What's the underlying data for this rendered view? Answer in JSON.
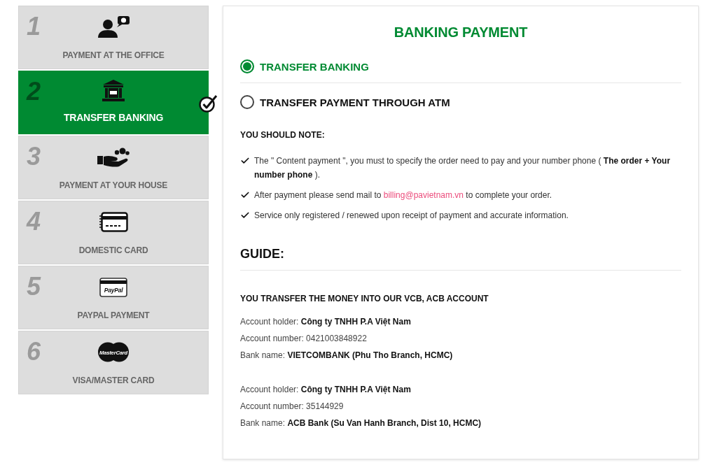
{
  "payment_methods": [
    {
      "number": "1",
      "label": "PAYMENT AT THE OFFICE",
      "kind": "office",
      "selected": false
    },
    {
      "number": "2",
      "label": "TRANSFER BANKING",
      "kind": "bank",
      "selected": true
    },
    {
      "number": "3",
      "label": "PAYMENT AT YOUR HOUSE",
      "kind": "hand",
      "selected": false
    },
    {
      "number": "4",
      "label": "DOMESTIC CARD",
      "kind": "card",
      "selected": false
    },
    {
      "number": "5",
      "label": "PAYPAL PAYMENT",
      "kind": "paypal",
      "logo_text": "PayPal",
      "selected": false
    },
    {
      "number": "6",
      "label": "VISA/MASTER CARD",
      "kind": "mastercard",
      "logo_text": "MasterCard",
      "selected": false
    }
  ],
  "panel": {
    "title": "BANKING PAYMENT",
    "options": [
      {
        "label": "TRANSFER BANKING",
        "selected": true
      },
      {
        "label": "TRANSFER PAYMENT THROUGH ATM",
        "selected": false
      }
    ],
    "note_heading": "YOU SHOULD NOTE:",
    "notes": [
      {
        "text": "The \" Content payment \", you must to specify the order need to pay and your number phone ( **The order + Your number phone** )."
      },
      {
        "text": "After payment please send mail to",
        "link": "billing@pavietnam.vn",
        "text_after": "to complete your order."
      },
      {
        "text": "Service only registered / renewed upon receipt of payment and accurate information."
      }
    ],
    "guide_heading": "GUIDE:",
    "guide_subheading": "YOU TRANSFER THE MONEY INTO OUR VCB, ACB ACCOUNT",
    "accounts": [
      {
        "lines": [
          "Account holder: **Công ty TNHH P.A Việt Nam**",
          "Account number: 0421003848922",
          "Bank name: **VIETCOMBANK (Phu Tho Branch, HCMC)**"
        ]
      },
      {
        "lines": [
          "Account holder: **Công ty TNHH P.A Việt Nam**",
          "Account number: 35144929",
          "Bank name: **ACB Bank (Su Van Hanh Branch, Dist 10, HCMC)**"
        ]
      }
    ]
  }
}
